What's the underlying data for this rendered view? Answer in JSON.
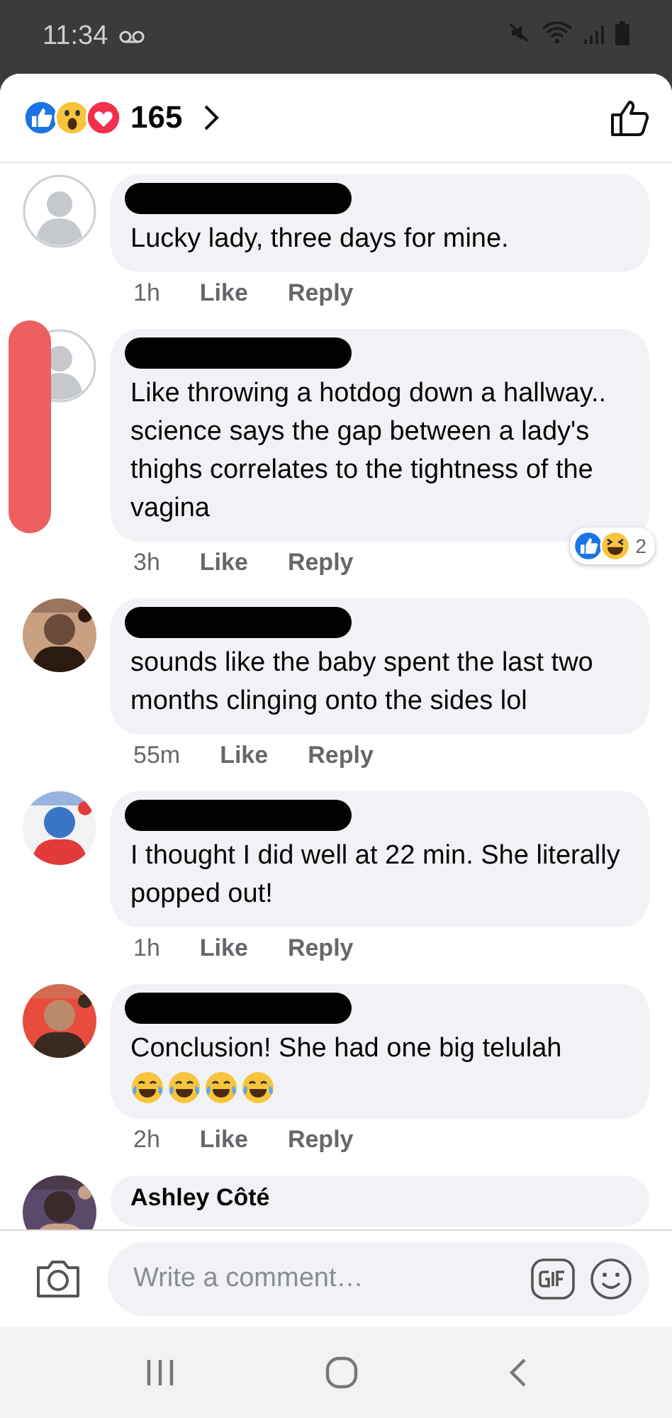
{
  "status_bar": {
    "time": "11:34"
  },
  "header": {
    "reactions": [
      {
        "kind": "like"
      },
      {
        "kind": "wow"
      },
      {
        "kind": "love"
      }
    ],
    "count": "165"
  },
  "comments": [
    {
      "avatar": {
        "kind": "default"
      },
      "redacted_name": true,
      "text": "Lucky lady, three days for mine.",
      "time": "1h",
      "like": "Like",
      "reply": "Reply"
    },
    {
      "avatar": {
        "kind": "default"
      },
      "redacted_name": true,
      "redacted_avatar": true,
      "text": "Like throwing a hotdog down a hallway.. science says the gap between a lady's thighs correlates to the tightness of the vagina",
      "time": "3h",
      "like": "Like",
      "reply": "Reply",
      "reactions": [
        {
          "kind": "like"
        },
        {
          "kind": "haha"
        }
      ],
      "reaction_count": "2"
    },
    {
      "redacted_name": true,
      "text": "sounds like the baby spent the last two months clinging onto the sides lol",
      "time": "55m",
      "like": "Like",
      "reply": "Reply"
    },
    {
      "redacted_name": true,
      "text": "I thought I did well at 22 min. She literally popped out!",
      "time": "1h",
      "like": "Like",
      "reply": "Reply"
    },
    {
      "redacted_name": true,
      "text": "Conclusion! She had one big telulah",
      "emojis": [
        {
          "kind": "tears_of_joy"
        },
        {
          "kind": "tears_of_joy"
        },
        {
          "kind": "tears_of_joy"
        },
        {
          "kind": "tears_of_joy"
        }
      ],
      "time": "2h",
      "like": "Like",
      "reply": "Reply"
    },
    {
      "author": "Ashley Côté"
    }
  ],
  "composer": {
    "placeholder": "Write a comment…"
  }
}
